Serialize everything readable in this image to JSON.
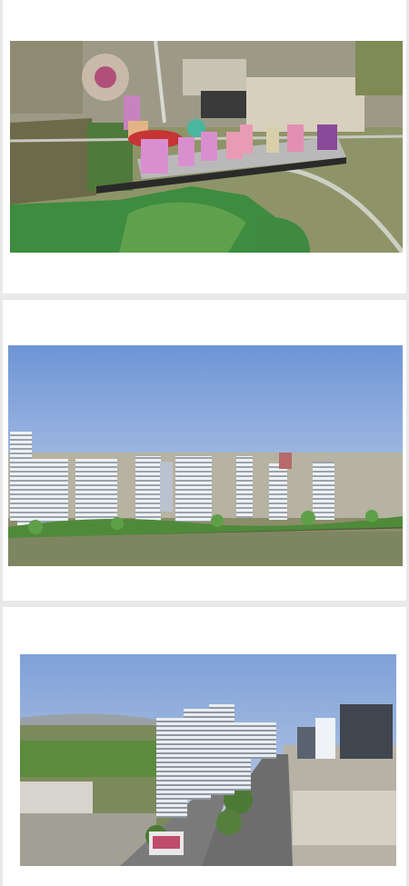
{
  "feed": {
    "cards": [
      {
        "image": "aerial-site-render"
      },
      {
        "image": "skyline-rendering"
      },
      {
        "image": "street-view-rendering"
      }
    ]
  },
  "colors": {
    "page_background": "#e9e9ec",
    "card_background": "#ffffff",
    "sky": "#8fb0df",
    "terrain": "#8e9a6a",
    "tower_pink": "#d98fb4",
    "tower_purple": "#8a4a9a",
    "tower_white": "#e9eef3"
  }
}
